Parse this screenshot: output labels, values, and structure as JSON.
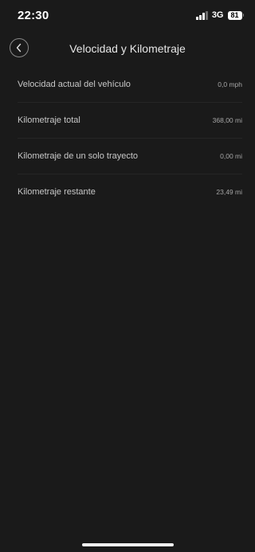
{
  "status_bar": {
    "time": "22:30",
    "network": "3G",
    "battery": "81"
  },
  "header": {
    "title": "Velocidad y Kilometraje",
    "back_icon": "chevron-left-icon"
  },
  "items": [
    {
      "label": "Velocidad actual del vehículo",
      "value": "0,0 mph"
    },
    {
      "label": "Kilometraje total",
      "value": "368,00 mi"
    },
    {
      "label": "Kilometraje de un solo trayecto",
      "value": "0,00 mi"
    },
    {
      "label": "Kilometraje restante",
      "value": "23,49 mi"
    }
  ],
  "colors": {
    "background": "#1a1a1a",
    "text": "#c8c8c8",
    "value_text": "#a6a6a6"
  }
}
